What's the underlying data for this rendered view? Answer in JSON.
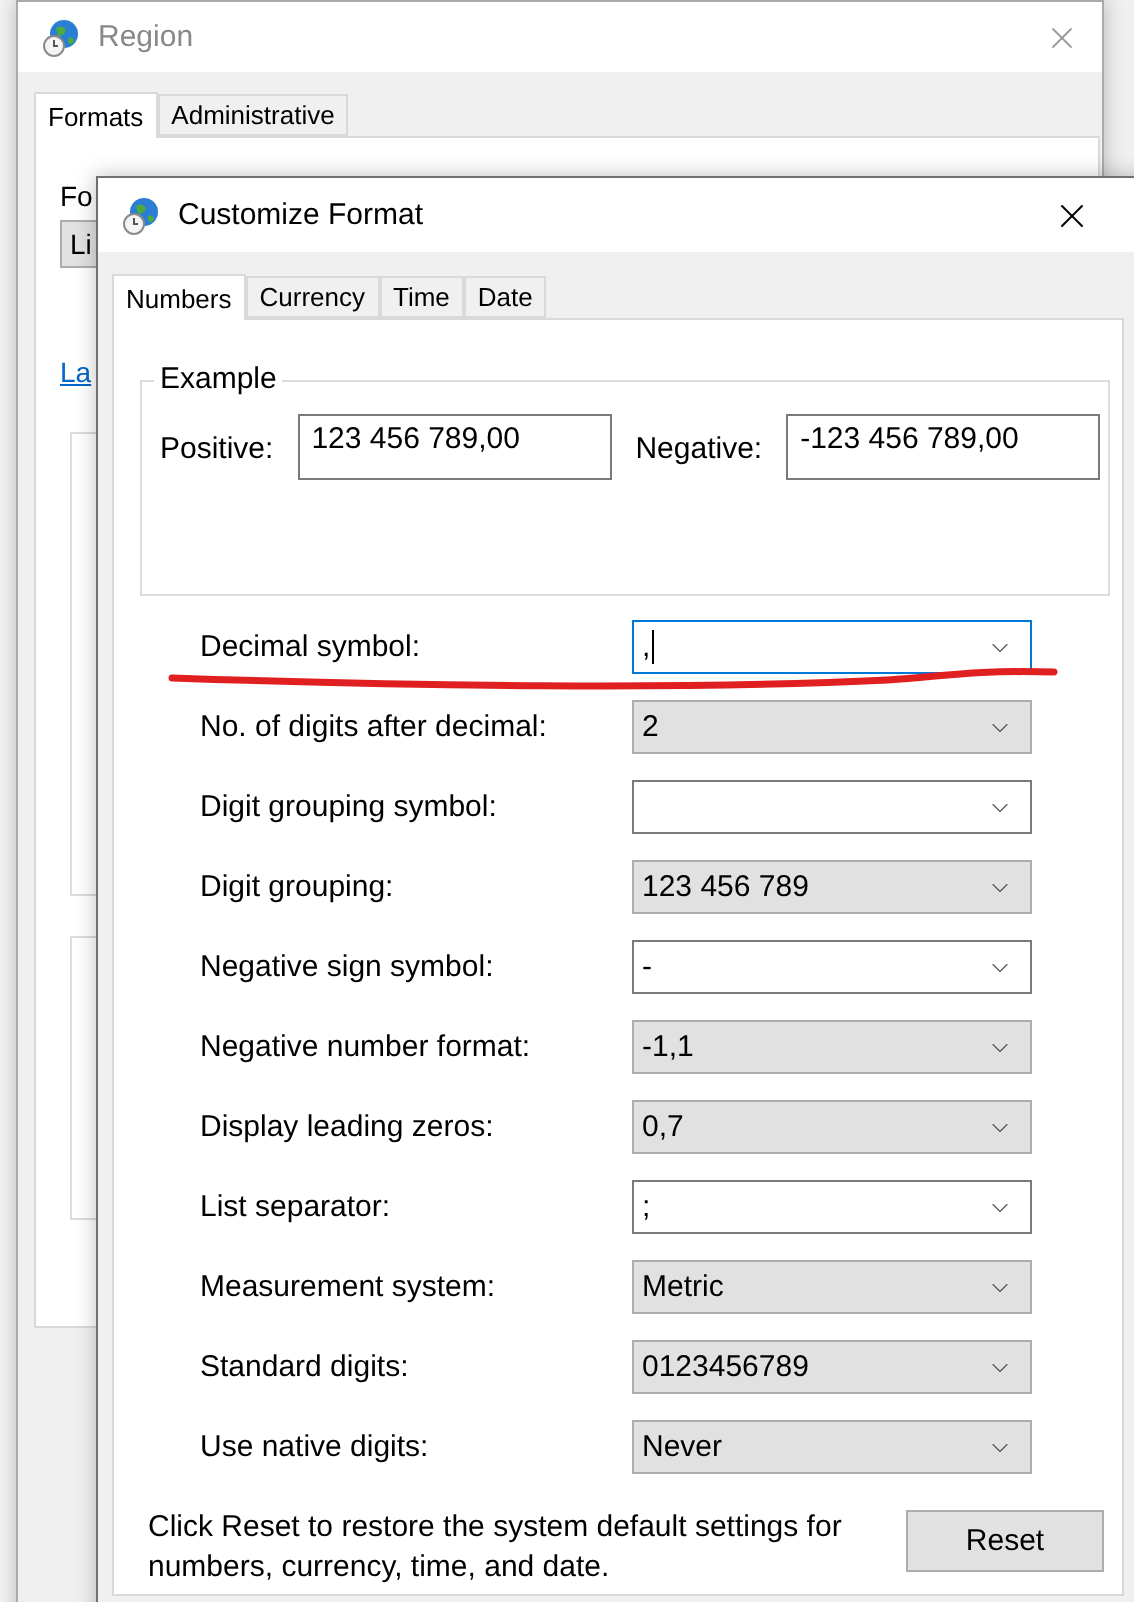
{
  "region_window": {
    "title": "Region",
    "tabs": [
      {
        "label": "Formats",
        "selected": true
      },
      {
        "label": "Administrative",
        "selected": false
      }
    ],
    "format_label": "Fo",
    "format_dropdown": "Li",
    "link": "La"
  },
  "dialog": {
    "title": "Customize Format",
    "tabs": [
      {
        "label": "Numbers",
        "selected": true
      },
      {
        "label": "Currency",
        "selected": false
      },
      {
        "label": "Time",
        "selected": false
      },
      {
        "label": "Date",
        "selected": false
      }
    ],
    "example": {
      "legend": "Example",
      "positive_label": "Positive:",
      "positive_value": "123 456 789,00",
      "negative_label": "Negative:",
      "negative_value": "-123 456 789,00"
    },
    "settings": [
      {
        "label": "Decimal symbol:",
        "value": ",",
        "kind": "editable",
        "focused": true
      },
      {
        "label": "No. of digits after decimal:",
        "value": "2",
        "kind": "list",
        "focused": false
      },
      {
        "label": "Digit grouping symbol:",
        "kind": "editable",
        "focused": false
      },
      {
        "label": "Digit grouping:",
        "value": "123 456 789",
        "kind": "list",
        "focused": false
      },
      {
        "label": "Negative sign symbol:",
        "value": "-",
        "kind": "editable",
        "focused": false
      },
      {
        "label": "Negative number format:",
        "value": "-1,1",
        "kind": "list",
        "focused": false
      },
      {
        "label": "Display leading zeros:",
        "value": "0,7",
        "kind": "list",
        "focused": false
      },
      {
        "label": "List separator:",
        "value": ";",
        "kind": "editable",
        "focused": false
      },
      {
        "label": "Measurement system:",
        "value": "Metric",
        "kind": "list",
        "focused": false
      },
      {
        "label": "Standard digits:",
        "value": "0123456789",
        "kind": "list",
        "focused": false
      },
      {
        "label": "Use native digits:",
        "value": "Never",
        "kind": "list",
        "focused": false
      }
    ],
    "note_lines": [
      "Click Reset to restore the system default settings for",
      "numbers, currency, time, and date."
    ],
    "reset_button": "Reset"
  }
}
